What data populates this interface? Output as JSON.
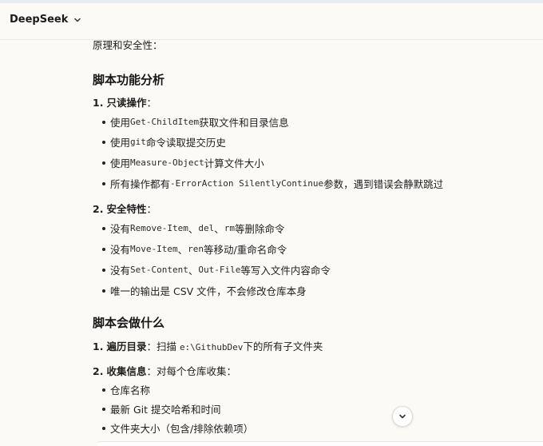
{
  "header": {
    "brand": "DeepSeek"
  },
  "content": {
    "intro": "原理和安全性：",
    "section1": {
      "heading": "脚本功能分析",
      "item1": {
        "num": "1.",
        "title": "只读操作",
        "colon": "：",
        "bullets": [
          {
            "pre": "使用 ",
            "code": "Get-ChildItem",
            "post": "获取文件和目录信息"
          },
          {
            "pre": "使用 ",
            "code": "git",
            "post": "命令读取提交历史"
          },
          {
            "pre": "使用 ",
            "code": "Measure-Object",
            "post": "计算文件大小"
          },
          {
            "pre": "所有操作都有 ",
            "code": "-ErrorAction SilentlyContinue",
            "post": "参数，遇到错误会静默跳过"
          }
        ]
      },
      "item2": {
        "num": "2.",
        "title": "安全特性",
        "colon": "：",
        "bullets": [
          {
            "pre": "没有 ",
            "code": "Remove-Item",
            "mid": "、",
            "code2": "del",
            "mid2": "、",
            "code3": "rm",
            "post": "等删除命令"
          },
          {
            "pre": "没有 ",
            "code": "Move-Item",
            "mid": "、",
            "code2": "ren",
            "post": "等移动/重命名命令"
          },
          {
            "pre": "没有 ",
            "code": "Set-Content",
            "mid": "、",
            "code2": "Out-File",
            "post": "等写入文件内容命令"
          },
          {
            "text": "唯一的输出是 CSV 文件，不会修改仓库本身"
          }
        ]
      }
    },
    "section2": {
      "heading": "脚本会做什么",
      "item1": {
        "num": "1.",
        "title": "遍历目录",
        "colon": "：扫描 ",
        "code": "e:\\GithubDev",
        "post": "下的所有子文件夹"
      },
      "item2": {
        "num": "2.",
        "title": "收集信息",
        "colon": "：对每个仓库收集：",
        "bullets": [
          {
            "text": "仓库名称"
          },
          {
            "text": "最新 Git 提交哈希和时间"
          },
          {
            "text": "文件夹大小（包含/排除依赖项）"
          }
        ]
      }
    }
  },
  "icons": {
    "brand_chevron": "chevron-down-icon",
    "scroll_down": "arrow-down-icon"
  }
}
